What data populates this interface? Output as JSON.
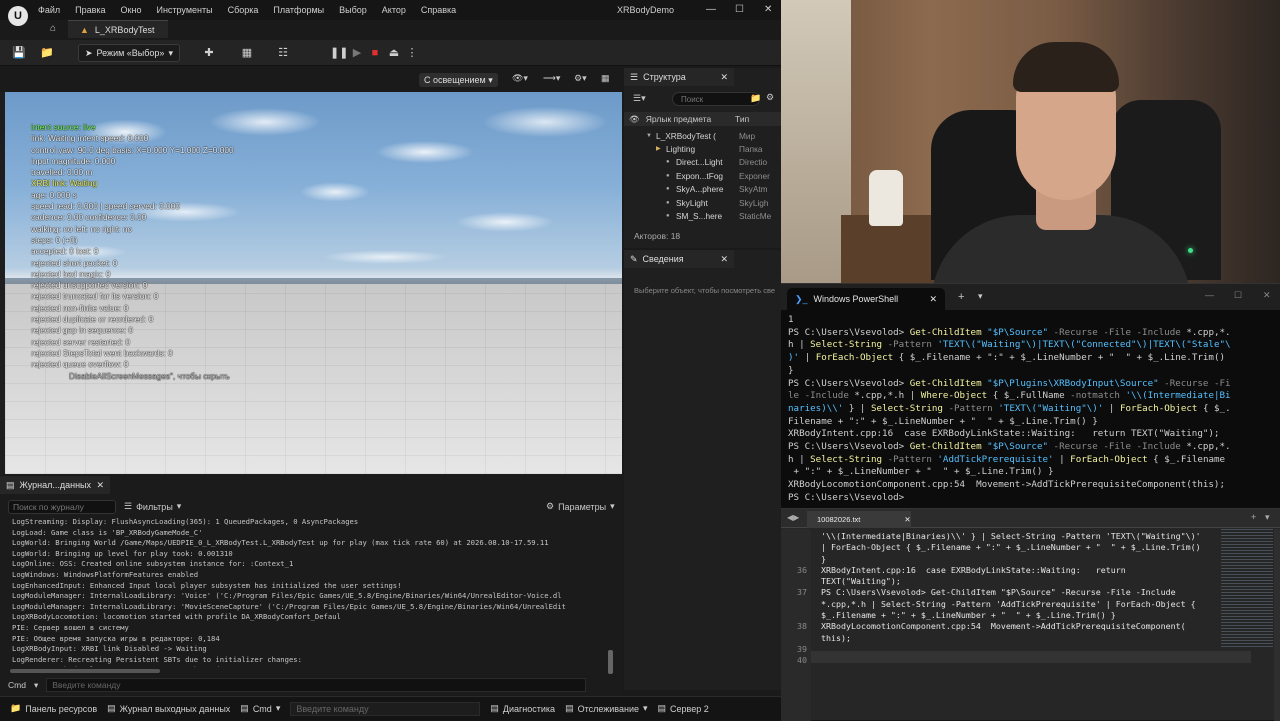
{
  "ue": {
    "logo": "U",
    "menu": [
      "Файл",
      "Правка",
      "Окно",
      "Инструменты",
      "Сборка",
      "Платформы",
      "Выбор",
      "Актор",
      "Справка"
    ],
    "window_title": "XRBodyDemo",
    "level_tab": "L_XRBodyTest",
    "mode_button": "Режим «Выбор»",
    "viewport_lighting": "С освещением",
    "debug_lines": [
      {
        "text": "intent source: live",
        "color": "green"
      },
      {
        "text": "link: Waiting  intent speed: 0.000",
        "color": "white"
      },
      {
        "text": "control yaw: 90.0 deg  basis: X=0.000 Y=1.000 Z=0.000",
        "color": "white"
      },
      {
        "text": "input magnitude: 0.000",
        "color": "white"
      },
      {
        "text": "travelled: 0.00 m",
        "color": "white"
      },
      {
        "text": "XRBI link: Waiting",
        "color": "yellow"
      },
      {
        "text": "age: 0.000 s",
        "color": "white"
      },
      {
        "text": "speed read: 0.000 | speed served: 0.000",
        "color": "white"
      },
      {
        "text": "cadence: 0.00  confidence: 0.00",
        "color": "white"
      },
      {
        "text": "walking: no  left: no  right: no",
        "color": "white"
      },
      {
        "text": "steps: 0 (+0)",
        "color": "white"
      },
      {
        "text": "accepted: 0  lost: 0",
        "color": "white"
      },
      {
        "text": "rejected short packet: 0",
        "color": "white"
      },
      {
        "text": "rejected bad magic: 0",
        "color": "white"
      },
      {
        "text": "rejected unsupported version: 0",
        "color": "white"
      },
      {
        "text": "rejected truncated for its version: 0",
        "color": "white"
      },
      {
        "text": "rejected non-finite value: 0",
        "color": "white"
      },
      {
        "text": "rejected duplicate or reordered: 0",
        "color": "white"
      },
      {
        "text": "rejected gap in sequence: 0",
        "color": "white"
      },
      {
        "text": "rejected server restarted: 0",
        "color": "white"
      },
      {
        "text": "rejected StepsTotal went backwards: 0",
        "color": "white"
      },
      {
        "text": "rejected queue overflow: 0",
        "color": "white"
      },
      {
        "text": "DisableAllScreenMessages\", чтобы скрыть",
        "color": "dim"
      }
    ],
    "outliner": {
      "title": "Структура",
      "search_placeholder": "Поиск",
      "col_label": "Ярлык предмета",
      "col_type": "Тип",
      "rows": [
        {
          "name": "L_XRBodyTest (",
          "type": "Мир",
          "indent": 0
        },
        {
          "name": "Lighting",
          "type": "Папка",
          "indent": 1
        },
        {
          "name": "Direct...Light",
          "type": "Directio",
          "indent": 2
        },
        {
          "name": "Expon...tFog",
          "type": "Exponer",
          "indent": 2
        },
        {
          "name": "SkyA...phere",
          "type": "SkyAtm",
          "indent": 2
        },
        {
          "name": "SkyLight",
          "type": "SkyLigh",
          "indent": 2
        },
        {
          "name": "SM_S...here",
          "type": "StaticMe",
          "indent": 2
        }
      ],
      "actors_count": "Акторов: 18"
    },
    "details": {
      "title": "Сведения",
      "hint": "Выберите объект, чтобы посмотреть све"
    },
    "log": {
      "tab": "Журнал...данных",
      "search_placeholder": "Поиск по журналу",
      "filters": "Фильтры",
      "params": "Параметры",
      "lines": [
        "LogStreaming: Display: FlushAsyncLoading(365): 1 QueuedPackages, 0 AsyncPackages",
        "LogLoad: Game class is 'BP_XRBodyGameMode_C'",
        "LogWorld: Bringing World /Game/Maps/UEDPIE_0_L_XRBodyTest.L_XRBodyTest up for play (max tick rate 60) at 2026.08.10-17.59.11",
        "LogWorld: Bringing up level for play took: 0.001310",
        "LogOnline: OSS: Created online subsystem instance for: :Context_1",
        "LogWindows: WindowsPlatformFeatures enabled",
        "LogEnhancedInput: Enhanced Input local player subsystem has initialized the user settings!",
        "LogModuleManager: InternalLoadLibrary: 'Voice' ('C:/Program Files/Epic Games/UE_5.8/Engine/Binaries/Win64/UnrealEditor-Voice.dl",
        "LogModuleManager: InternalLoadLibrary: 'MovieSceneCapture' ('C:/Program Files/Epic Games/UE_5.8/Engine/Binaries/Win64/UnrealEdit",
        "LogXRBodyLocomotion: locomotion started with profile DA_XRBodyComfort_Defaul",
        "PIE: Сервер вошел в систему",
        "PIE: Общее время запуска игры в редакторе: 0,184",
        "LogXRBodyInput: XRBI link Disabled -> Waiting",
        "LogRenderer: Recreating Persistent SBTs due to initializer changes:",
        "        NumShaderSlotsPerGeometrySegment changed: current: 1 - new: 2",
        "        NumGeometrySegments changed: current: 0 - new: 512"
      ],
      "cmd_label": "Cmd",
      "cmd_placeholder": "Введите команду"
    },
    "statusbar": {
      "content_browser": "Панель ресурсов",
      "output_log": "Журнал выходных данных",
      "cmd": "Cmd",
      "cmd_placeholder": "Введите команду",
      "diagnostics": "Диагностика",
      "tracking": "Отслеживание",
      "server": "Сервер 2"
    }
  },
  "powershell": {
    "tab_title": "Windows PowerShell",
    "lines": [
      [
        {
          "t": "1",
          "c": "w"
        }
      ],
      [
        {
          "t": "PS C:\\Users\\Vsevolod> ",
          "c": "w"
        },
        {
          "t": "Get-ChildItem ",
          "c": "y"
        },
        {
          "t": "\"$P\\Source\" ",
          "c": "b"
        },
        {
          "t": "-Recurse -File -Include ",
          "c": "g"
        },
        {
          "t": "*.cpp,*.",
          "c": "w"
        }
      ],
      [
        {
          "t": "h | ",
          "c": "w"
        },
        {
          "t": "Select-String ",
          "c": "y"
        },
        {
          "t": "-Pattern ",
          "c": "g"
        },
        {
          "t": "'TEXT\\(\"Waiting\"\\)|TEXT\\(\"Connected\"\\)|TEXT\\(\"Stale\"\\",
          "c": "b"
        }
      ],
      [
        {
          "t": ")' ",
          "c": "b"
        },
        {
          "t": "| ",
          "c": "w"
        },
        {
          "t": "ForEach-Object ",
          "c": "y"
        },
        {
          "t": "{ $_.Filename + \":\" + $_.LineNumber + \"  \" + $_.Line.Trim()",
          "c": "w"
        }
      ],
      [
        {
          "t": "}",
          "c": "w"
        }
      ],
      [
        {
          "t": "PS C:\\Users\\Vsevolod> ",
          "c": "w"
        },
        {
          "t": "Get-ChildItem ",
          "c": "y"
        },
        {
          "t": "\"$P\\Plugins\\XRBodyInput\\Source\" ",
          "c": "b"
        },
        {
          "t": "-Recurse -Fi",
          "c": "g"
        }
      ],
      [
        {
          "t": "le -Include ",
          "c": "g"
        },
        {
          "t": "*.cpp,*.h | ",
          "c": "w"
        },
        {
          "t": "Where-Object ",
          "c": "y"
        },
        {
          "t": "{ $_.FullName ",
          "c": "w"
        },
        {
          "t": "-notmatch ",
          "c": "g"
        },
        {
          "t": "'\\\\(Intermediate|Bi",
          "c": "b"
        }
      ],
      [
        {
          "t": "naries)\\\\' ",
          "c": "b"
        },
        {
          "t": "} | ",
          "c": "w"
        },
        {
          "t": "Select-String ",
          "c": "y"
        },
        {
          "t": "-Pattern ",
          "c": "g"
        },
        {
          "t": "'TEXT\\(\"Waiting\"\\)' ",
          "c": "b"
        },
        {
          "t": "| ",
          "c": "w"
        },
        {
          "t": "ForEach-Object ",
          "c": "y"
        },
        {
          "t": "{ $_.",
          "c": "w"
        }
      ],
      [
        {
          "t": "Filename + \":\" + $_.LineNumber + \"  \" + $_.Line.Trim() }",
          "c": "w"
        }
      ],
      [
        {
          "t": "XRBodyIntent.cpp:16  case EXRBodyLinkState::Waiting:   return TEXT(\"Waiting\");",
          "c": "w"
        }
      ],
      [
        {
          "t": "PS C:\\Users\\Vsevolod> ",
          "c": "w"
        },
        {
          "t": "Get-ChildItem ",
          "c": "y"
        },
        {
          "t": "\"$P\\Source\" ",
          "c": "b"
        },
        {
          "t": "-Recurse -File -Include ",
          "c": "g"
        },
        {
          "t": "*.cpp,*.",
          "c": "w"
        }
      ],
      [
        {
          "t": "h | ",
          "c": "w"
        },
        {
          "t": "Select-String ",
          "c": "y"
        },
        {
          "t": "-Pattern ",
          "c": "g"
        },
        {
          "t": "'AddTickPrerequisite' ",
          "c": "b"
        },
        {
          "t": "| ",
          "c": "w"
        },
        {
          "t": "ForEach-Object ",
          "c": "y"
        },
        {
          "t": "{ $_.Filename",
          "c": "w"
        }
      ],
      [
        {
          "t": " + \":\" + $_.LineNumber + \"  \" + $_.Line.Trim() }",
          "c": "w"
        }
      ],
      [
        {
          "t": "XRBodyLocomotionComponent.cpp:54  Movement->AddTickPrerequisiteComponent(this);",
          "c": "w"
        }
      ],
      [
        {
          "t": "PS C:\\Users\\Vsevolod>",
          "c": "w"
        }
      ]
    ]
  },
  "notepad": {
    "tab_title": "10082026.txt",
    "lines": [
      {
        "n": "",
        "t": "'\\\\(Intermediate|Binaries)\\\\' } | Select-String -Pattern 'TEXT\\(\"Waiting\"\\)'"
      },
      {
        "n": "",
        "t": "| ForEach-Object { $_.Filename + \":\" + $_.LineNumber + \"  \" + $_.Line.Trim()"
      },
      {
        "n": "",
        "t": "}"
      },
      {
        "n": "36",
        "t": "XRBodyIntent.cpp:16  case EXRBodyLinkState::Waiting:   return"
      },
      {
        "n": "",
        "t": "TEXT(\"Waiting\");"
      },
      {
        "n": "37",
        "t": "PS C:\\Users\\Vsevolod> Get-ChildItem \"$P\\Source\" -Recurse -File -Include"
      },
      {
        "n": "",
        "t": "*.cpp,*.h | Select-String -Pattern 'AddTickPrerequisite' | ForEach-Object {"
      },
      {
        "n": "",
        "t": "$_.Filename + \":\" + $_.LineNumber + \"  \" + $_.Line.Trim() }"
      },
      {
        "n": "38",
        "t": "XRBodyLocomotionComponent.cpp:54  Movement->AddTickPrerequisiteComponent("
      },
      {
        "n": "",
        "t": "this);"
      },
      {
        "n": "39",
        "t": ""
      },
      {
        "n": "40",
        "t": ""
      }
    ]
  }
}
